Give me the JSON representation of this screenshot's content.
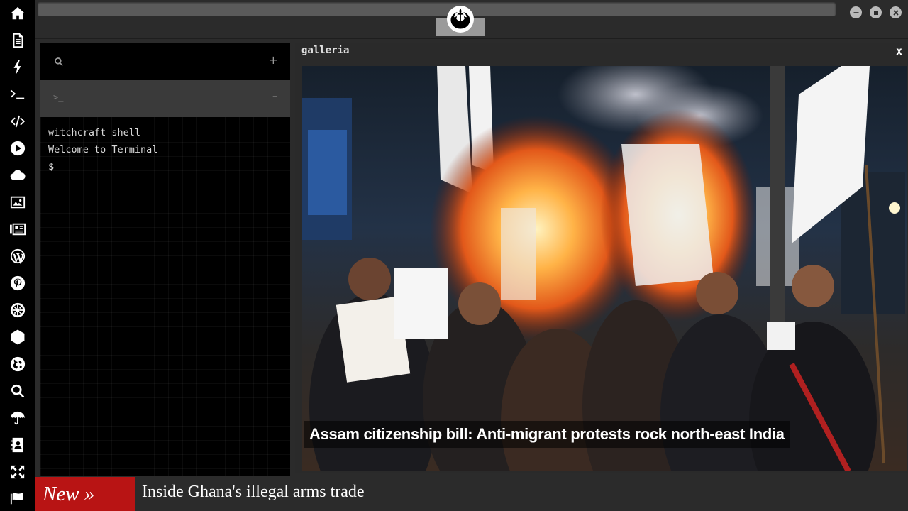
{
  "sidebar": {
    "icons": [
      "home-icon",
      "document-icon",
      "bolt-icon",
      "terminal-icon",
      "code-icon",
      "play-icon",
      "cloud-icon",
      "image-icon",
      "news-icon",
      "wordpress-icon",
      "pinterest-icon",
      "settings-wheel-icon",
      "network-icon",
      "globe-icon",
      "search-icon",
      "umbrella-icon",
      "contacts-icon",
      "expand-icon",
      "flag-icon"
    ]
  },
  "window": {
    "logo": "rebel-alliance-icon"
  },
  "terminal": {
    "search_add": "+",
    "tab_prompt": ">_",
    "tab_minimize": "–",
    "lines": [
      "witchcraft shell",
      "Welcome to Terminal",
      "$"
    ]
  },
  "gallery": {
    "title": "galleria",
    "close": "x",
    "caption": "Assam citizenship bill: Anti-migrant protests rock north-east India"
  },
  "ticker": {
    "tag": "New »",
    "headline": "Inside Ghana's illegal arms trade"
  },
  "colors": {
    "accent_red": "#b81414",
    "sidebar_bg": "#000000",
    "chrome_bg": "#2b2b2b"
  }
}
